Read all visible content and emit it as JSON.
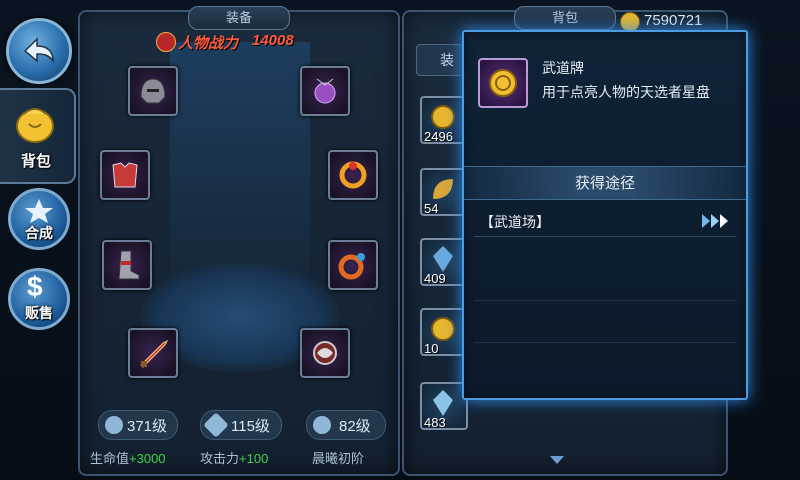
{
  "currency": {
    "value": "7590721"
  },
  "nav": {
    "items": [
      {
        "label": "背包"
      },
      {
        "label": "合成"
      },
      {
        "label": "贩售"
      }
    ]
  },
  "equip_panel": {
    "title": "装备",
    "power_label": "人物战力",
    "power_value": "14008",
    "stats": [
      {
        "badge": "371级",
        "label": "生命值",
        "bonus": "+3000"
      },
      {
        "badge": "115级",
        "label": "攻击力",
        "bonus": "+100"
      },
      {
        "badge": "82级",
        "label": "晨曦初阶",
        "bonus": ""
      }
    ]
  },
  "bag_panel": {
    "title": "背包",
    "tab_left": "装",
    "slots": [
      {
        "count": "2496"
      },
      {
        "count": "54"
      },
      {
        "count": "409"
      },
      {
        "count": "10"
      },
      {
        "count": "483"
      }
    ]
  },
  "popup": {
    "item_name": "武道牌",
    "item_desc": "用于点亮人物的天选者星盘",
    "obtain_title": "获得途径",
    "sources": [
      {
        "label": "【武道场】"
      }
    ]
  },
  "colors": {
    "accent": "#4d9be0",
    "stat_bonus": "#43d14a",
    "power": "#ff5a3c"
  }
}
